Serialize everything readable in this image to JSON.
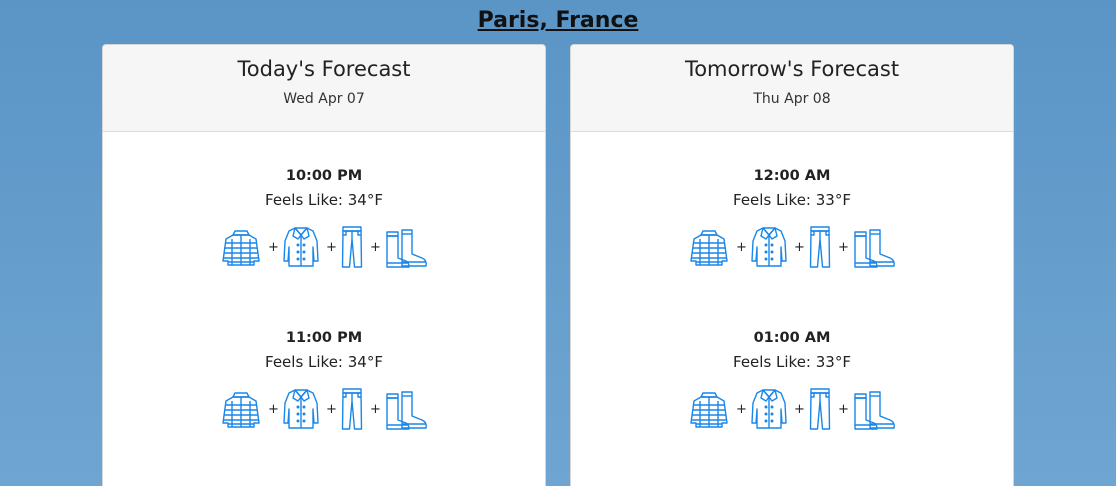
{
  "location": "Paris, France",
  "icon_color": "#1a86e8",
  "forecasts": [
    {
      "title": "Today's Forecast",
      "date": "Wed Apr 07",
      "hours": [
        {
          "time": "10:00 PM",
          "feels": "Feels Like: 34°F",
          "outfit": [
            "puffer-jacket-icon",
            "coat-icon",
            "pants-icon",
            "boots-icon"
          ],
          "separator": "+"
        },
        {
          "time": "11:00 PM",
          "feels": "Feels Like: 34°F",
          "outfit": [
            "puffer-jacket-icon",
            "coat-icon",
            "pants-icon",
            "boots-icon"
          ],
          "separator": "+"
        }
      ]
    },
    {
      "title": "Tomorrow's Forecast",
      "date": "Thu Apr 08",
      "hours": [
        {
          "time": "12:00 AM",
          "feels": "Feels Like: 33°F",
          "outfit": [
            "puffer-jacket-icon",
            "coat-icon",
            "pants-icon",
            "boots-icon"
          ],
          "separator": "+"
        },
        {
          "time": "01:00 AM",
          "feels": "Feels Like: 33°F",
          "outfit": [
            "puffer-jacket-icon",
            "coat-icon",
            "pants-icon",
            "boots-icon"
          ],
          "separator": "+"
        }
      ]
    }
  ]
}
